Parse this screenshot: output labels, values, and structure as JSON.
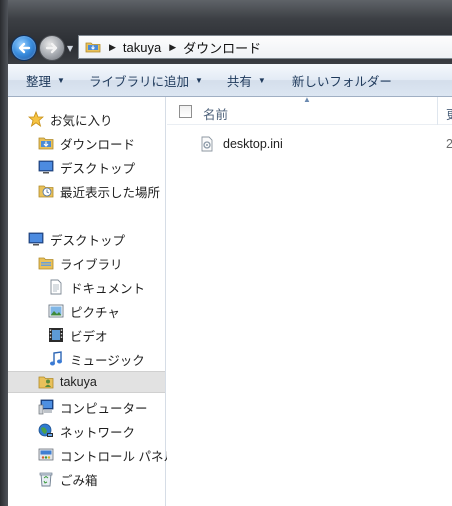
{
  "address_bar": {
    "crumbs": [
      "takuya",
      "ダウンロード"
    ]
  },
  "toolbar": {
    "organize": "整理",
    "add_to_library": "ライブラリに追加",
    "share": "共有",
    "new_folder": "新しいフォルダー"
  },
  "nav": {
    "favorites": "お気に入り",
    "downloads": "ダウンロード",
    "desktop_fav": "デスクトップ",
    "recent": "最近表示した場所",
    "desktop_root": "デスクトップ",
    "libraries": "ライブラリ",
    "documents": "ドキュメント",
    "pictures": "ピクチャ",
    "videos": "ビデオ",
    "music": "ミュージック",
    "user": "takuya",
    "computer": "コンピューター",
    "network": "ネットワーク",
    "control_panel": "コントロール パネル",
    "recycle_bin": "ごみ箱"
  },
  "columns": {
    "name": "名前",
    "date_partial": "更"
  },
  "files": [
    {
      "name": "desktop.ini",
      "date_partial": "2"
    }
  ],
  "icons": {
    "back": "back-arrow-icon",
    "forward": "forward-arrow-icon",
    "folder": "folder-icon",
    "star": "star-icon"
  },
  "colors": {
    "toolbar_text": "#1e395b",
    "header_text": "#4c607a",
    "back_button": "#3b8fe0",
    "selected_bg": "#e2e2e2"
  }
}
